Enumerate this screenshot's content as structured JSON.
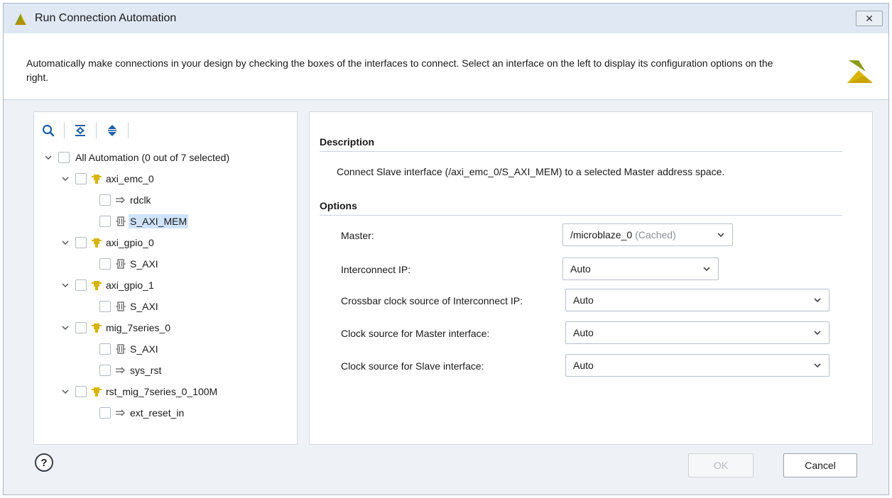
{
  "window": {
    "title": "Run Connection Automation",
    "close_glyph": "✕"
  },
  "banner": {
    "description": "Automatically make connections in your design by checking the boxes of the interfaces to connect. Select an interface on the left to display its configuration options on the right."
  },
  "toolbar": {
    "icons": [
      "search-icon",
      "collapse-all-icon",
      "expand-all-icon"
    ]
  },
  "tree": {
    "root": "All Automation (0 out of 7 selected)",
    "n_axi_emc_0": "axi_emc_0",
    "n_rdclk": "rdclk",
    "n_s_axi_mem": "S_AXI_MEM",
    "n_axi_gpio_0": "axi_gpio_0",
    "n_s_axi_1": "S_AXI",
    "n_axi_gpio_1": "axi_gpio_1",
    "n_s_axi_2": "S_AXI",
    "n_mig_7series_0": "mig_7series_0",
    "n_s_axi_3": "S_AXI",
    "n_sys_rst": "sys_rst",
    "n_rst_mig": "rst_mig_7series_0_100M",
    "n_ext_reset_in": "ext_reset_in",
    "selected_item": "S_AXI_MEM"
  },
  "details": {
    "description_heading": "Description",
    "description_text": "Connect Slave interface (/axi_emc_0/S_AXI_MEM) to a selected Master address space.",
    "options_heading": "Options",
    "master_label": "Master:",
    "master_value": "/microblaze_0",
    "master_suffix": "(Cached)",
    "interconnect_label": "Interconnect IP:",
    "interconnect_value": "Auto",
    "crossbar_label": "Crossbar clock source of Interconnect IP:",
    "crossbar_value": "Auto",
    "master_clock_label": "Clock source for Master interface:",
    "master_clock_value": "Auto",
    "slave_clock_label": "Clock source for Slave interface:",
    "slave_clock_value": "Auto"
  },
  "footer": {
    "help": "?",
    "ok": "OK",
    "cancel": "Cancel"
  },
  "colors": {
    "accent_gold": "#c9a400",
    "logo_green": "#8a9a1a",
    "selection": "#cfe3fb"
  }
}
